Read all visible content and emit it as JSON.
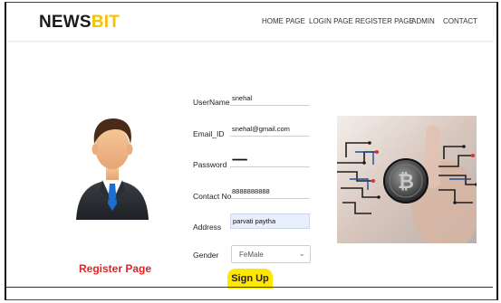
{
  "brand": {
    "part1": "NEWS",
    "part2": "BIT"
  },
  "nav": [
    "HOME PAGE",
    "LOGIN PAGE",
    "REGISTER PAGE",
    "ADMIN",
    "CONTACT"
  ],
  "form": {
    "username": {
      "label": "UserName",
      "value": "snehal"
    },
    "email": {
      "label": "Email_ID",
      "value": "snehal@gmail.com"
    },
    "password": {
      "label": "Password",
      "value": "••••••••••"
    },
    "contact": {
      "label": "Contact No.",
      "value": "8888888888"
    },
    "address": {
      "label": "Address",
      "value": "parvati paytha"
    },
    "gender": {
      "label": "Gender",
      "value": "FeMale"
    },
    "submit_label": "Sign Up"
  },
  "page_title": "Register Page",
  "colors": {
    "brand_accent": "#f2c200",
    "title_red": "#e82020",
    "button_yellow": "#ffe800"
  },
  "icons": {
    "select_arrow": "chevron-down-icon"
  }
}
